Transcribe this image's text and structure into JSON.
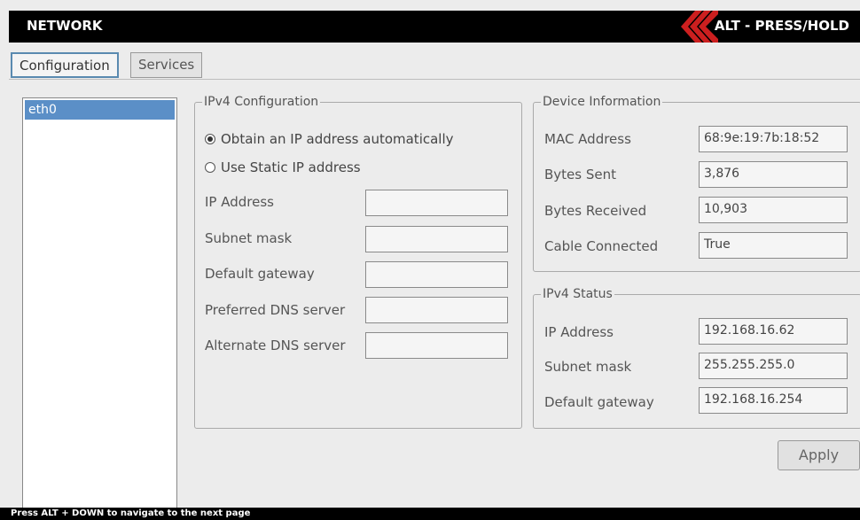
{
  "header": {
    "title": "NETWORK",
    "alt_hint": "ALT - PRESS/HOLD"
  },
  "tabs": [
    {
      "label": "Configuration"
    },
    {
      "label": "Services"
    }
  ],
  "interfaces": [
    "eth0"
  ],
  "ipv4_config": {
    "legend": "IPv4 Configuration",
    "radio_auto": "Obtain an IP address automatically",
    "radio_static": "Use Static IP address",
    "fields": [
      {
        "label": "IP Address",
        "value": ""
      },
      {
        "label": "Subnet mask",
        "value": ""
      },
      {
        "label": "Default gateway",
        "value": ""
      },
      {
        "label": "Preferred DNS server",
        "value": ""
      },
      {
        "label": "Alternate DNS server",
        "value": ""
      }
    ]
  },
  "device_info": {
    "legend": "Device Information",
    "rows": [
      {
        "label": "MAC Address",
        "value": "68:9e:19:7b:18:52"
      },
      {
        "label": "Bytes Sent",
        "value": "3,876"
      },
      {
        "label": "Bytes Received",
        "value": "10,903"
      },
      {
        "label": "Cable Connected",
        "value": "True"
      }
    ]
  },
  "ipv4_status": {
    "legend": "IPv4 Status",
    "rows": [
      {
        "label": "IP Address",
        "value": "192.168.16.62"
      },
      {
        "label": "Subnet mask",
        "value": "255.255.255.0"
      },
      {
        "label": "Default gateway",
        "value": "192.168.16.254"
      }
    ]
  },
  "apply_label": "Apply",
  "footer": "Press ALT + DOWN to navigate to the next page",
  "colors": {
    "accent": "#cc1f1f",
    "selection": "#5b8fc7",
    "bar": "#000000"
  }
}
